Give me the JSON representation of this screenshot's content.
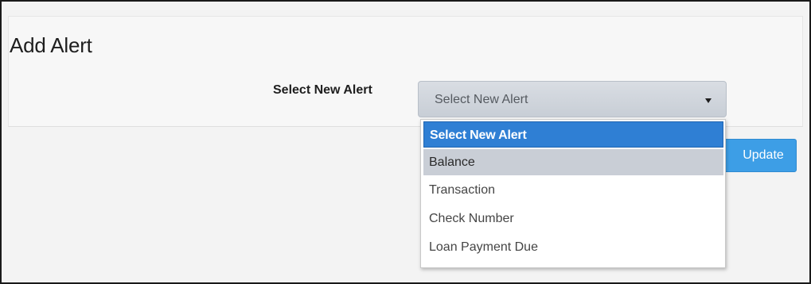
{
  "page": {
    "title": "Add Alert"
  },
  "alert_form": {
    "label": "Select New Alert",
    "select_value": "Select New Alert",
    "options": [
      {
        "label": "Select New Alert",
        "state": "selected"
      },
      {
        "label": "Balance",
        "state": "hover"
      },
      {
        "label": "Transaction",
        "state": "normal"
      },
      {
        "label": "Check Number",
        "state": "normal"
      },
      {
        "label": "Loan Payment Due",
        "state": "normal"
      }
    ],
    "update_label": "Update"
  },
  "colors": {
    "selected_option": "#2f7fd4",
    "hover_option": "#c9ced6",
    "update_button": "#3d9ee6"
  }
}
